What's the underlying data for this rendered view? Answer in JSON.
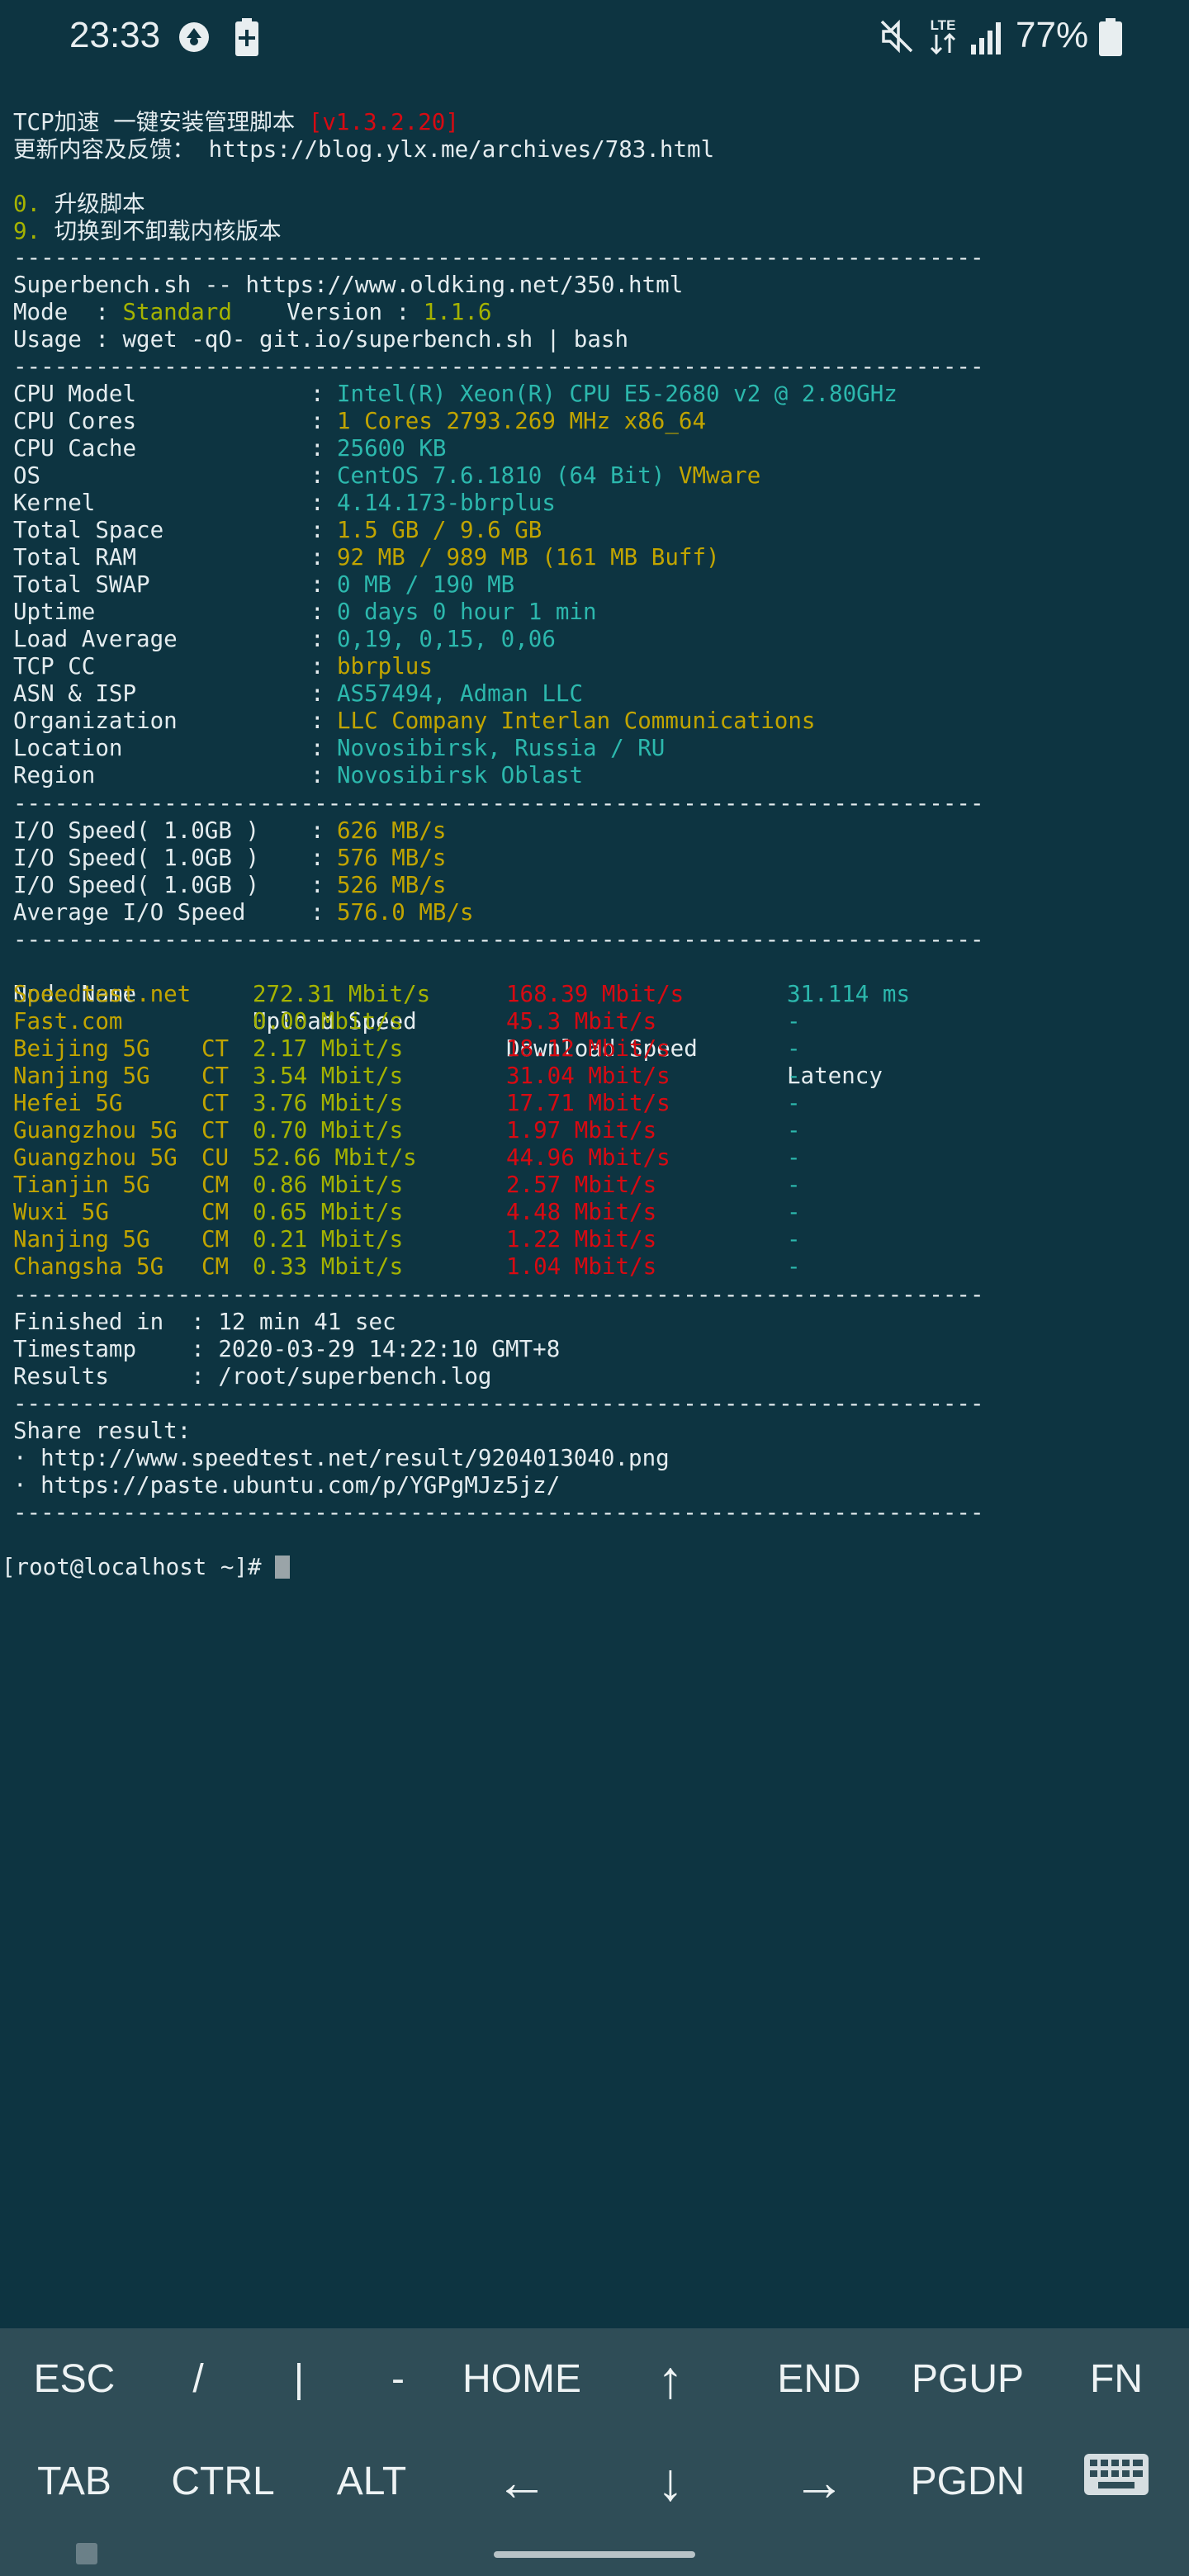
{
  "status_bar": {
    "time": "23:33",
    "battery_percent": "77%",
    "network_label": "LTE",
    "icons": [
      "app-notification-icon",
      "battery-saver-icon",
      "mute-icon",
      "lte-icon",
      "signal-icon",
      "battery-icon"
    ]
  },
  "terminal": {
    "header": {
      "title": "TCP加速 一键安装管理脚本 ",
      "version": "[v1.3.2.20]",
      "update_label": "更新内容及反馈： ",
      "update_url": "https://blog.ylx.me/archives/783.html",
      "opt0_num": "0.",
      "opt0_text": " 升级脚本",
      "opt9_num": "9.",
      "opt9_text": " 切换到不卸载内核版本"
    },
    "separator": "-----------------------------------------------------------------------",
    "superbench": {
      "line1": "Superbench.sh -- https://www.oldking.net/350.html",
      "mode_label": "Mode  : ",
      "mode_value": "Standard",
      "version_label": "    Version : ",
      "version_value": "1.1.6",
      "usage": "Usage : wget -qO- git.io/superbench.sh | bash"
    },
    "sysinfo": [
      {
        "label": "CPU Model",
        "value": "Intel(R) Xeon(R) CPU E5-2680 v2 @ 2.80GHz"
      },
      {
        "label": "CPU Cores",
        "value": "1 Cores 2793.269 MHz x86_64"
      },
      {
        "label": "CPU Cache",
        "value": "25600 KB"
      },
      {
        "label": "OS",
        "value": "CentOS 7.6.1810 (64 Bit) ",
        "value2": "VMware"
      },
      {
        "label": "Kernel",
        "value": "4.14.173-bbrplus"
      },
      {
        "label": "Total Space",
        "value": "1.5 GB / 9.6 GB"
      },
      {
        "label": "Total RAM",
        "value": "92 MB / 989 MB (161 MB Buff)"
      },
      {
        "label": "Total SWAP",
        "value": "0 MB / 190 MB"
      },
      {
        "label": "Uptime",
        "value": "0 days 0 hour 1 min"
      },
      {
        "label": "Load Average",
        "value": "0,19, 0,15, 0,06"
      },
      {
        "label": "TCP CC",
        "value": "bbrplus"
      },
      {
        "label": "ASN & ISP",
        "value": "AS57494, Adman LLC"
      },
      {
        "label": "Organization",
        "value": "LLC Company Interlan Communications"
      },
      {
        "label": "Location",
        "value": "Novosibirsk, Russia / RU"
      },
      {
        "label": "Region",
        "value": "Novosibirsk Oblast"
      }
    ],
    "colon": ": ",
    "io": [
      {
        "label": "I/O Speed( 1.0GB )",
        "value": "626 MB/s"
      },
      {
        "label": "I/O Speed( 1.0GB )",
        "value": "576 MB/s"
      },
      {
        "label": "I/O Speed( 1.0GB )",
        "value": "526 MB/s"
      },
      {
        "label": "Average I/O Speed",
        "value": "576.0 MB/s"
      }
    ],
    "speed_headers": {
      "node": "Node Name",
      "upload": "Upload Speed",
      "download": "Download Speed",
      "latency": "Latency"
    },
    "speed_rows": [
      {
        "node": "Speedtest.net",
        "isp": "",
        "upload": "272.31 Mbit/s",
        "download": "168.39 Mbit/s",
        "latency": "31.114 ms"
      },
      {
        "node": "Fast.com",
        "isp": "",
        "upload": "0.00 Mbit/s",
        "download": "45.3 Mbit/s",
        "latency": "-"
      },
      {
        "node": "Beijing 5G",
        "isp": "CT",
        "upload": "2.17 Mbit/s",
        "download": "18.12 Mbit/s",
        "latency": "-"
      },
      {
        "node": "Nanjing 5G",
        "isp": "CT",
        "upload": "3.54 Mbit/s",
        "download": "31.04 Mbit/s",
        "latency": "-"
      },
      {
        "node": "Hefei 5G",
        "isp": "CT",
        "upload": "3.76 Mbit/s",
        "download": "17.71 Mbit/s",
        "latency": "-"
      },
      {
        "node": "Guangzhou 5G",
        "isp": "CT",
        "upload": "0.70 Mbit/s",
        "download": "1.97 Mbit/s",
        "latency": "-"
      },
      {
        "node": "Guangzhou 5G",
        "isp": "CU",
        "upload": "52.66 Mbit/s",
        "download": "44.96 Mbit/s",
        "latency": "-"
      },
      {
        "node": "Tianjin 5G",
        "isp": "CM",
        "upload": "0.86 Mbit/s",
        "download": "2.57 Mbit/s",
        "latency": "-"
      },
      {
        "node": "Wuxi 5G",
        "isp": "CM",
        "upload": "0.65 Mbit/s",
        "download": "4.48 Mbit/s",
        "latency": "-"
      },
      {
        "node": "Nanjing 5G",
        "isp": "CM",
        "upload": "0.21 Mbit/s",
        "download": "1.22 Mbit/s",
        "latency": "-"
      },
      {
        "node": "Changsha 5G",
        "isp": "CM",
        "upload": "0.33 Mbit/s",
        "download": "1.04 Mbit/s",
        "latency": "-"
      }
    ],
    "summary": {
      "finished": "Finished in  : 12 min 41 sec",
      "timestamp": "Timestamp    : 2020-03-29 14:22:10 GMT+8",
      "results": "Results      : /root/superbench.log"
    },
    "share": {
      "title": "Share result:",
      "link1": "· http://www.speedtest.net/result/9204013040.png",
      "link2": "· https://paste.ubuntu.com/p/YGPgMJz5jz/"
    },
    "prompt": "[root@localhost ~]# "
  },
  "extra_keys": {
    "row1": [
      "ESC",
      "/",
      "|",
      "-",
      "HOME",
      "↑",
      "END",
      "PGUP",
      "FN"
    ],
    "row2": [
      "TAB",
      "CTRL",
      "ALT",
      "←",
      "↓",
      "→",
      "PGDN",
      "keyboard-icon"
    ]
  },
  "colors": {
    "background": "#0d3441",
    "cyan": "#2cb8ad",
    "yellow": "#c1a400",
    "olive": "#a5b300",
    "red": "#d70a12"
  }
}
